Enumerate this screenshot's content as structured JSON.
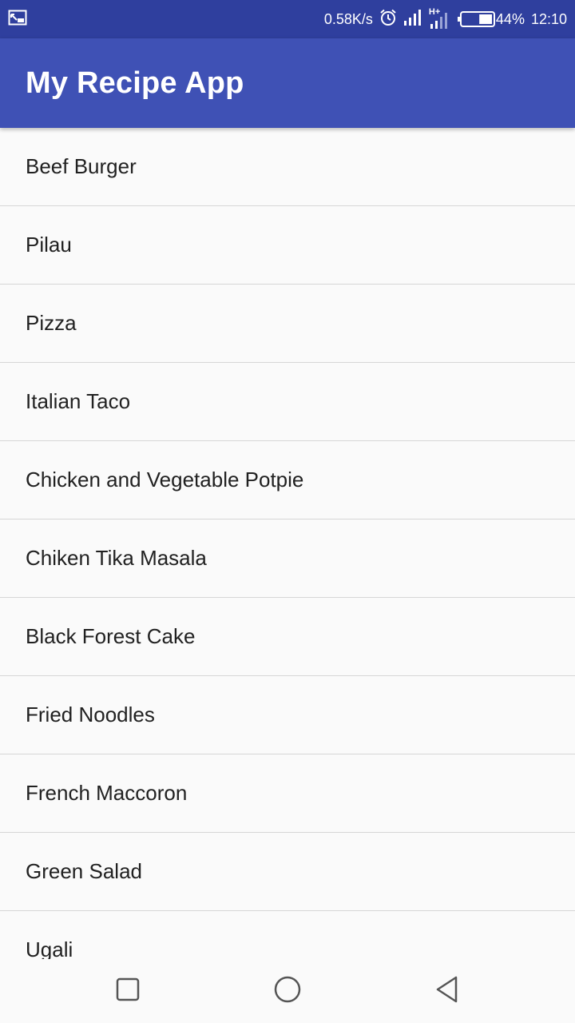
{
  "status_bar": {
    "network_speed": "0.58K/s",
    "battery_percent": "44%",
    "time": "12:10",
    "network_type": "H+",
    "battery_level": 0.44,
    "icons": [
      "screen-cast-icon",
      "alarm-clock-icon",
      "signal-strength-icon",
      "signal-strength-h-plus-icon",
      "battery-icon"
    ]
  },
  "app_bar": {
    "title": "My Recipe App"
  },
  "recipes": [
    {
      "name": "Beef Burger"
    },
    {
      "name": "Pilau"
    },
    {
      "name": "Pizza"
    },
    {
      "name": "Italian Taco"
    },
    {
      "name": "Chicken and Vegetable Potpie"
    },
    {
      "name": "Chiken Tika Masala"
    },
    {
      "name": "Black Forest Cake"
    },
    {
      "name": "Fried Noodles"
    },
    {
      "name": "French Maccoron"
    },
    {
      "name": "Green Salad"
    },
    {
      "name": "Ugali"
    }
  ],
  "nav_bar": {
    "buttons": [
      "recent-apps-icon",
      "home-icon",
      "back-icon"
    ]
  },
  "colors": {
    "status_bar": "#2f3f9e",
    "app_bar": "#3f51b5",
    "background": "#fafafa",
    "divider": "#d6d6d6",
    "text": "#212121"
  }
}
